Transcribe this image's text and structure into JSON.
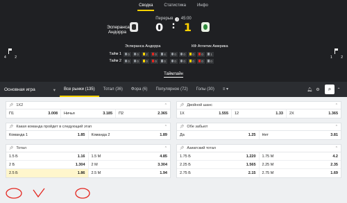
{
  "tabs": [
    "Сводка",
    "Статистика",
    "Инфо"
  ],
  "match": {
    "period": "Перерыв",
    "time": "45:00",
    "team1": "Эсперанса Андорра",
    "team2": "КФ Атлетик Америка",
    "score1": "0",
    "colon": ":",
    "score2": "1",
    "left_stats": {
      "corners": "4",
      "yellow": "2"
    },
    "right_stats": {
      "corners": "1",
      "yellow": "2"
    }
  },
  "stats": {
    "team1_label": "Эсперанса Андорра",
    "team2_label": "КФ Атлетик Америка",
    "rows": [
      {
        "label": "Тайм 1",
        "t1": [
          "0",
          "0",
          "2",
          "0",
          "4"
        ],
        "t2": [
          "0",
          "0",
          "0",
          "0",
          "1"
        ]
      },
      {
        "label": "Тайм 2",
        "t1": [
          "0",
          "0",
          "0",
          "0",
          "0"
        ],
        "t2": [
          "0",
          "0",
          "0",
          "0",
          "0"
        ]
      }
    ]
  },
  "timeline_label": "Таймлайн",
  "nav": {
    "main": "Основная игра",
    "tabs": [
      "Все рынки (135)",
      "Тотал (36)",
      "Фора (6)",
      "Популярное (72)",
      "Голы (30)",
      "≡ ▾"
    ]
  },
  "markets": {
    "m1x2": {
      "title": "1Х2",
      "row": [
        [
          "П1",
          "3.008"
        ],
        [
          "Ничья",
          "3.185"
        ],
        [
          "П2",
          "2.365"
        ]
      ]
    },
    "double": {
      "title": "Двойной шанс",
      "row": [
        [
          "1Х",
          "1.555"
        ],
        [
          "12",
          "1.33"
        ],
        [
          "2Х",
          "1.365"
        ]
      ]
    },
    "next": {
      "title": "Какая команда пройдет в следующий этап",
      "row": [
        [
          "Команда 1",
          "1.85"
        ],
        [
          "Команда 2",
          "1.89"
        ]
      ]
    },
    "btts": {
      "title": "Обе забьют",
      "row": [
        [
          "Да",
          "1.25"
        ],
        [
          "Нет",
          "3.81"
        ]
      ]
    },
    "total": {
      "title": "Тотал",
      "rows": [
        [
          [
            "1.5 Б",
            "1.16"
          ],
          [
            "1.5 М",
            "4.85"
          ]
        ],
        [
          [
            "2 Б",
            "1.304"
          ],
          [
            "2 М",
            "3.304"
          ]
        ],
        [
          [
            "2.5 Б",
            "1.86"
          ],
          [
            "2.5 М",
            "1.94"
          ]
        ]
      ]
    },
    "asian": {
      "title": "Азиатский тотал",
      "rows": [
        [
          [
            "1.75 Б",
            "1.220"
          ],
          [
            "1.75 М",
            "4.2"
          ]
        ],
        [
          [
            "2.25 Б",
            "1.565"
          ],
          [
            "2.25 М",
            "2.35"
          ]
        ],
        [
          [
            "2.75 Б",
            "2.15"
          ],
          [
            "2.75 М",
            "1.69"
          ]
        ]
      ]
    }
  },
  "colors": {
    "accent": "#ffd200",
    "header_bg": "#1f2023",
    "annotation": "#e4261f"
  }
}
